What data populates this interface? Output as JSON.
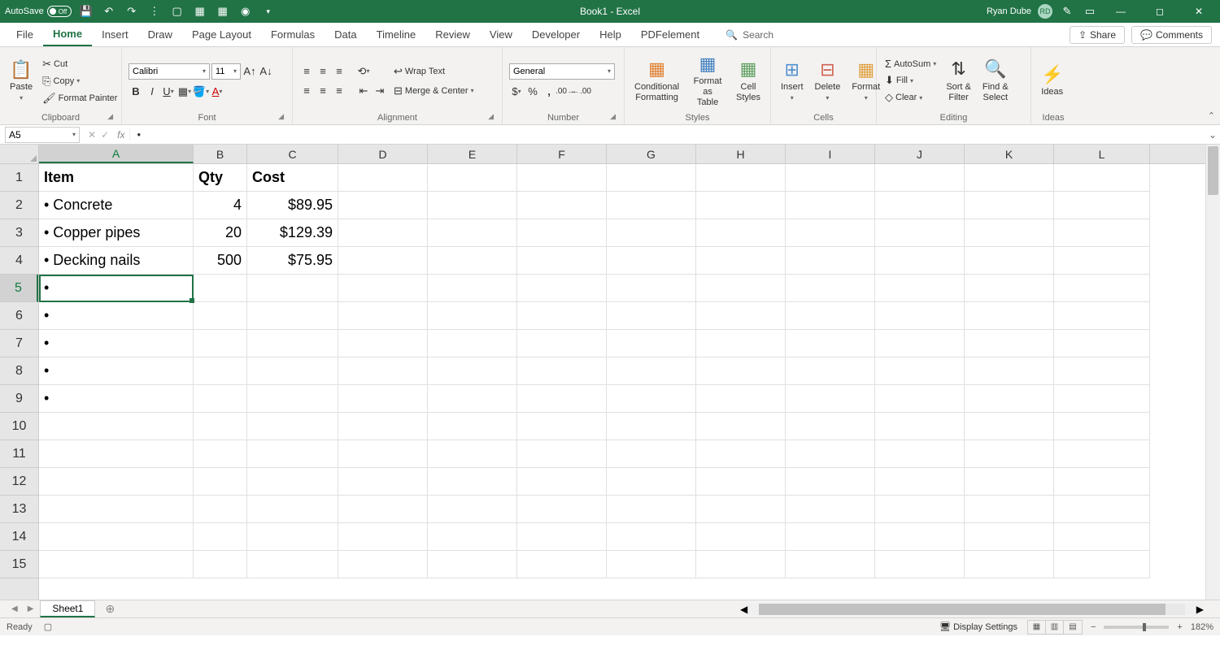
{
  "titlebar": {
    "autosave_label": "AutoSave",
    "autosave_state": "Off",
    "title": "Book1 - Excel",
    "user": "Ryan Dube",
    "initials": "RD"
  },
  "tabs": {
    "file": "File",
    "home": "Home",
    "insert": "Insert",
    "draw": "Draw",
    "page_layout": "Page Layout",
    "formulas": "Formulas",
    "data": "Data",
    "timeline": "Timeline",
    "review": "Review",
    "view": "View",
    "developer": "Developer",
    "help": "Help",
    "pdfelement": "PDFelement",
    "search": "Search",
    "share": "Share",
    "comments": "Comments"
  },
  "ribbon": {
    "clipboard": {
      "label": "Clipboard",
      "paste": "Paste",
      "cut": "Cut",
      "copy": "Copy",
      "format_painter": "Format Painter"
    },
    "font": {
      "label": "Font",
      "name": "Calibri",
      "size": "11"
    },
    "alignment": {
      "label": "Alignment",
      "wrap": "Wrap Text",
      "merge": "Merge & Center"
    },
    "number": {
      "label": "Number",
      "format": "General"
    },
    "styles": {
      "label": "Styles",
      "cf": "Conditional\nFormatting",
      "fat": "Format as\nTable",
      "cs": "Cell\nStyles"
    },
    "cells": {
      "label": "Cells",
      "insert": "Insert",
      "delete": "Delete",
      "format": "Format"
    },
    "editing": {
      "label": "Editing",
      "autosum": "AutoSum",
      "fill": "Fill",
      "clear": "Clear",
      "sort": "Sort &\nFilter",
      "find": "Find &\nSelect"
    },
    "ideas": {
      "label": "Ideas",
      "ideas": "Ideas"
    }
  },
  "formula_bar": {
    "namebox": "A5",
    "formula": "•"
  },
  "grid": {
    "cols": [
      "A",
      "B",
      "C",
      "D",
      "E",
      "F",
      "G",
      "H",
      "I",
      "J",
      "K",
      "L"
    ],
    "rows": [
      "1",
      "2",
      "3",
      "4",
      "5",
      "6",
      "7",
      "8",
      "9",
      "10",
      "11",
      "12",
      "13",
      "14",
      "15"
    ],
    "selected_cell": "A5",
    "data": {
      "A1": "Item",
      "B1": "Qty",
      "C1": "Cost",
      "A2": "• Concrete",
      "B2": "4",
      "C2": "$89.95",
      "A3": "• Copper pipes",
      "B3": "20",
      "C3": "$129.39",
      "A4": "• Decking nails",
      "B4": "500",
      "C4": "$75.95",
      "A5": "•",
      "A6": "•",
      "A7": "•",
      "A8": "•",
      "A9": "•"
    }
  },
  "sheets": {
    "active": "Sheet1"
  },
  "statusbar": {
    "ready": "Ready",
    "display_settings": "Display Settings",
    "zoom": "182%"
  }
}
